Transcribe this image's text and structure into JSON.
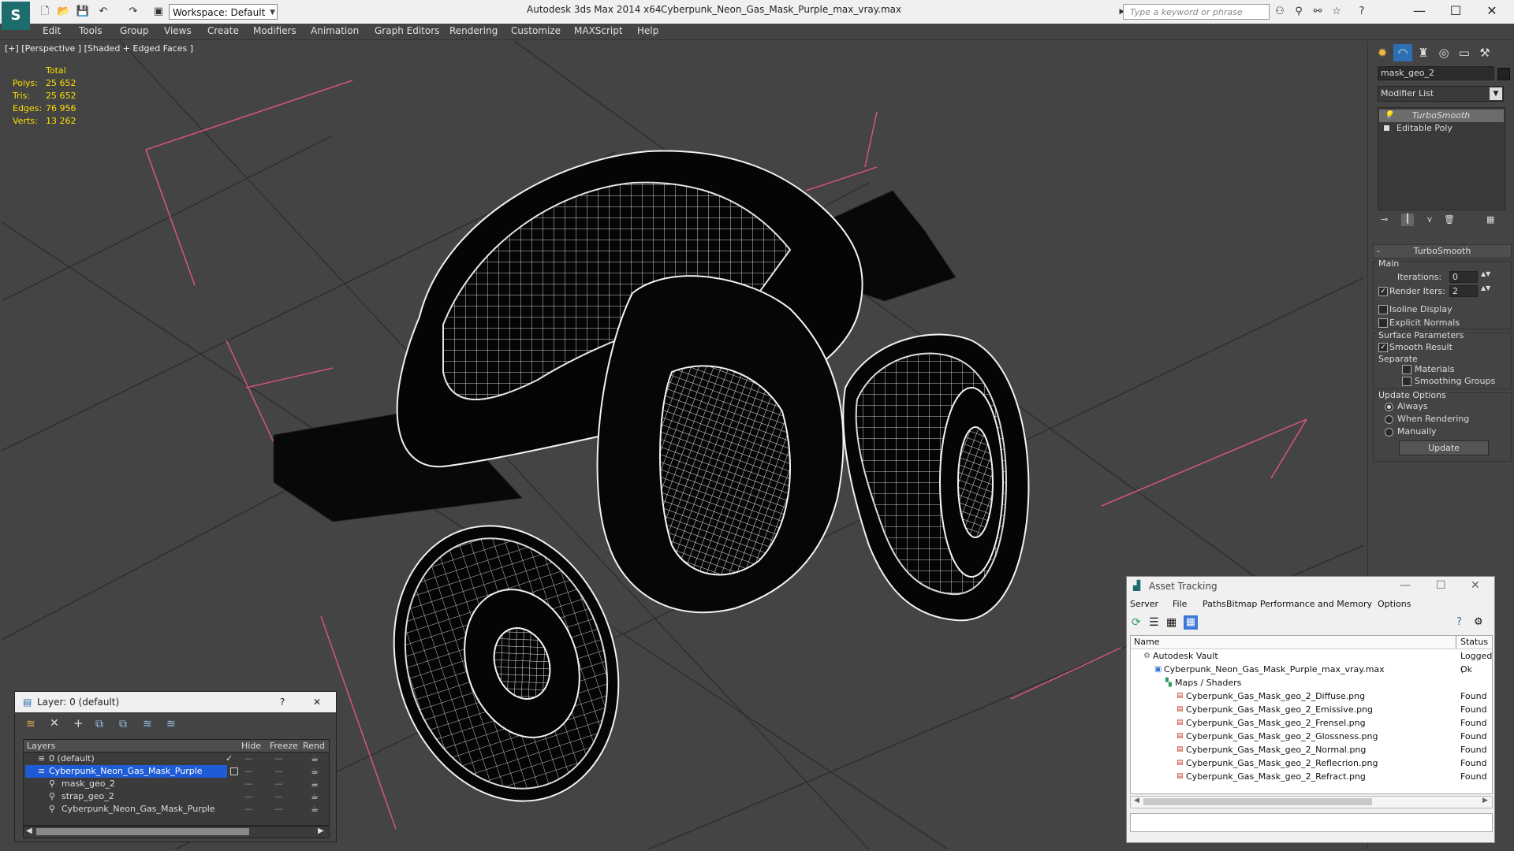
{
  "titlebar": {
    "app_title": "Autodesk 3ds Max  2014 x64",
    "file_name": "Cyberpunk_Neon_Gas_Mask_Purple_max_vray.max",
    "workspace_label": "Workspace: Default",
    "search_placeholder": "Type a keyword or phrase",
    "logo_glyph": "S"
  },
  "menu": [
    "Edit",
    "Tools",
    "Group",
    "Views",
    "Create",
    "Modifiers",
    "Animation",
    "Graph Editors",
    "Rendering",
    "Customize",
    "MAXScript",
    "Help"
  ],
  "viewport": {
    "label": "[+] [Perspective ] [Shaded + Edged Faces ]",
    "stats": {
      "header": "Total",
      "rows": [
        {
          "label": "Polys:",
          "value": "25 652"
        },
        {
          "label": "Tris:",
          "value": "25 652"
        },
        {
          "label": "Edges:",
          "value": "76 956"
        },
        {
          "label": "Verts:",
          "value": "13 262"
        }
      ]
    }
  },
  "command_panel": {
    "object_name": "mask_geo_2",
    "modifier_list_label": "Modifier List",
    "stack": [
      "TurboSmooth",
      "Editable Poly"
    ],
    "rollout_title": "TurboSmooth",
    "main_group": "Main",
    "iterations_label": "Iterations:",
    "iterations_value": "0",
    "render_iters_label": "Render Iters:",
    "render_iters_value": "2",
    "render_iters_checked": "✓",
    "isoline_label": "Isoline Display",
    "explicit_normals_label": "Explicit Normals",
    "surface_group": "Surface Parameters",
    "smooth_result_label": "Smooth Result",
    "smooth_result_checked": "✓",
    "separate_label": "Separate",
    "materials_label": "Materials",
    "smoothing_groups_label": "Smoothing Groups",
    "update_group": "Update Options",
    "always_label": "Always",
    "when_rendering_label": "When Rendering",
    "manually_label": "Manually",
    "update_button": "Update"
  },
  "layer_window": {
    "title": "Layer: 0 (default)",
    "help": "?",
    "close": "✕",
    "columns": [
      "Layers",
      "Hide",
      "Freeze",
      "Rend"
    ],
    "rows": [
      {
        "name": "0 (default)",
        "indent": 0,
        "selected": false,
        "mark": "✓"
      },
      {
        "name": "Cyberpunk_Neon_Gas_Mask_Purple",
        "indent": 0,
        "selected": true,
        "mark": ""
      },
      {
        "name": "mask_geo_2",
        "indent": 1,
        "selected": false,
        "mark": ""
      },
      {
        "name": "strap_geo_2",
        "indent": 1,
        "selected": false,
        "mark": ""
      },
      {
        "name": "Cyberpunk_Neon_Gas_Mask_Purple",
        "indent": 1,
        "selected": false,
        "mark": ""
      }
    ]
  },
  "asset_window": {
    "title": "Asset Tracking",
    "menu": [
      "Server",
      "File",
      "Paths",
      "Bitmap Performance and Memory",
      "Options"
    ],
    "columns": [
      "Name",
      "Status"
    ],
    "rows": [
      {
        "name": "Autodesk Vault",
        "status": "Logged (",
        "indent": 0
      },
      {
        "name": "Cyberpunk_Neon_Gas_Mask_Purple_max_vray.max",
        "status": "Ok",
        "indent": 1
      },
      {
        "name": "Maps / Shaders",
        "status": "",
        "indent": 2
      },
      {
        "name": "Cyberpunk_Gas_Mask_geo_2_Diffuse.png",
        "status": "Found",
        "indent": 3
      },
      {
        "name": "Cyberpunk_Gas_Mask_geo_2_Emissive.png",
        "status": "Found",
        "indent": 3
      },
      {
        "name": "Cyberpunk_Gas_Mask_geo_2_Frensel.png",
        "status": "Found",
        "indent": 3
      },
      {
        "name": "Cyberpunk_Gas_Mask_geo_2_Glossness.png",
        "status": "Found",
        "indent": 3
      },
      {
        "name": "Cyberpunk_Gas_Mask_geo_2_Normal.png",
        "status": "Found",
        "indent": 3
      },
      {
        "name": "Cyberpunk_Gas_Mask_geo_2_Reflecrion.png",
        "status": "Found",
        "indent": 3
      },
      {
        "name": "Cyberpunk_Gas_Mask_geo_2_Refract.png",
        "status": "Found",
        "indent": 3
      }
    ]
  },
  "colors": {
    "ui_dark": "#444444",
    "stats_text": "#ffdd00",
    "selection_blue": "#1e5bd6",
    "bounding_box": "#e0587a"
  }
}
